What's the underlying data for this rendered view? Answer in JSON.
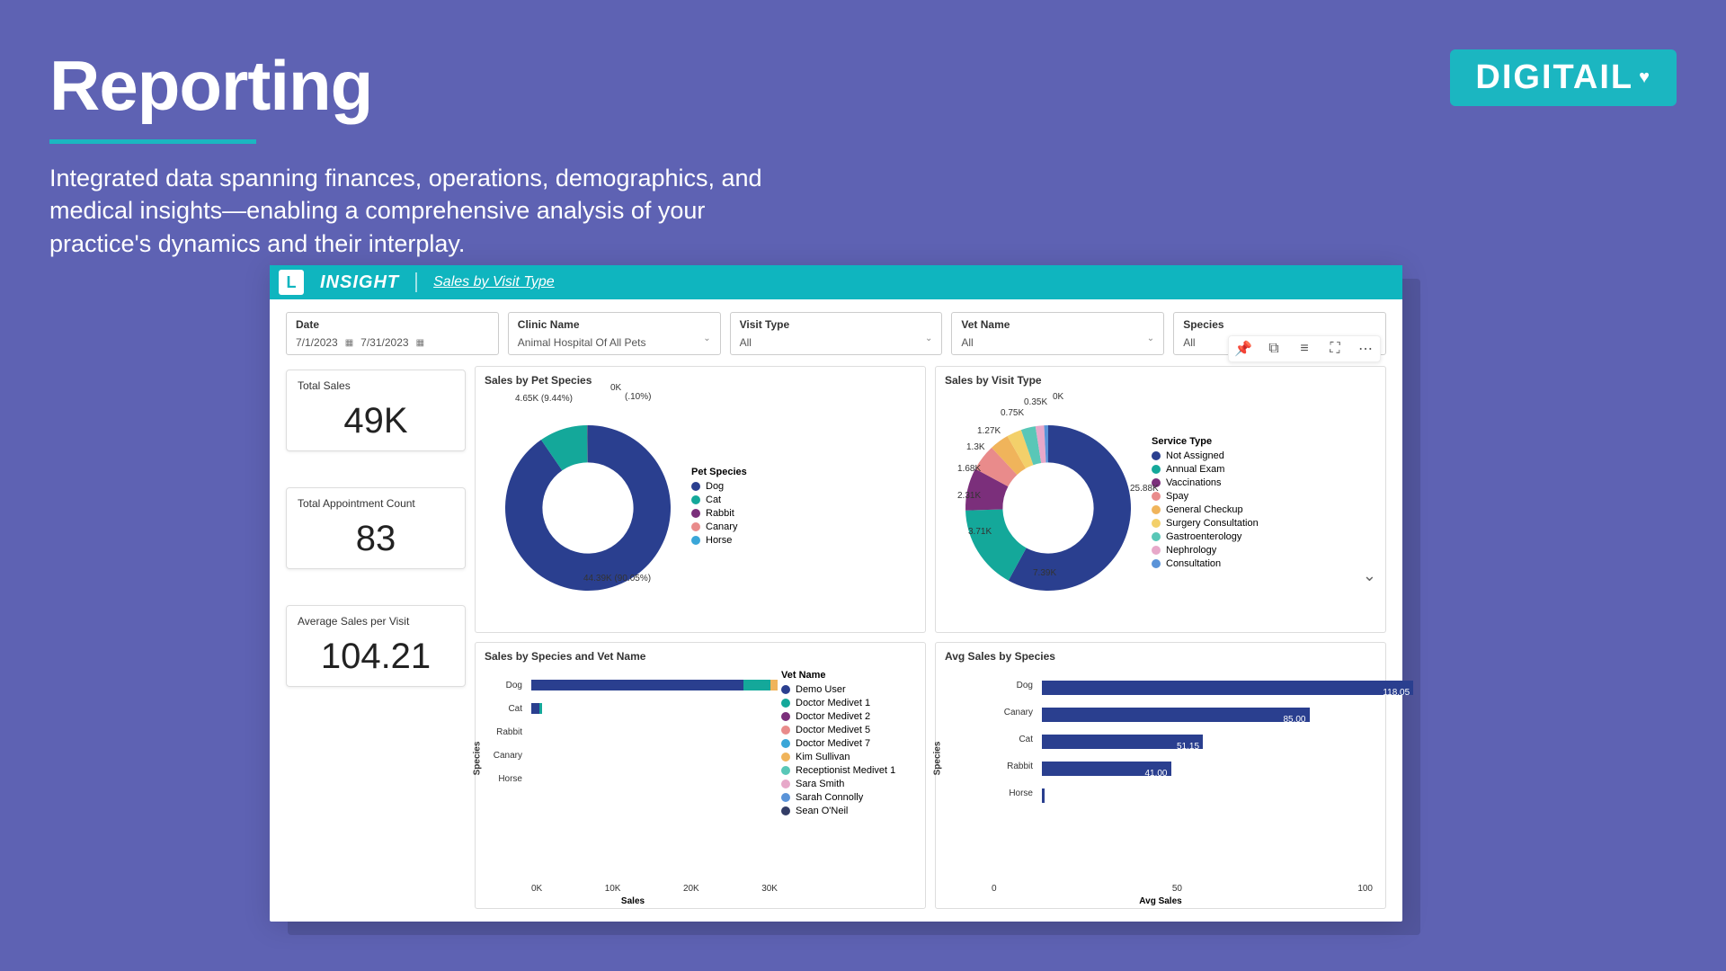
{
  "page": {
    "title": "Reporting",
    "subtitle": "Integrated data spanning finances, operations, demographics, and medical insights—enabling a comprehensive analysis of your practice's dynamics and their interplay."
  },
  "brand": {
    "name": "DIGITAIL"
  },
  "dashboard": {
    "product": "INSIGHT",
    "page_name": "Sales by Visit Type",
    "filters": {
      "date_label": "Date",
      "date_from": "7/1/2023",
      "date_to": "7/31/2023",
      "clinic_label": "Clinic Name",
      "clinic_value": "Animal Hospital Of All Pets",
      "visit_label": "Visit Type",
      "visit_value": "All",
      "vet_label": "Vet Name",
      "vet_value": "All",
      "species_label": "Species",
      "species_value": "All"
    },
    "kpis": {
      "total_sales_label": "Total Sales",
      "total_sales_value": "49K",
      "total_appt_label": "Total Appointment Count",
      "total_appt_value": "83",
      "avg_sales_label": "Average Sales per Visit",
      "avg_sales_value": "104.21"
    },
    "panel_species": {
      "title": "Sales by Pet Species",
      "legend_title": "Pet Species",
      "label_top": "0K",
      "label_pct_small": "(.10%)",
      "label_cat": "4.65K (9.44%)",
      "label_dog": "44.39K (90.05%)"
    },
    "panel_visit": {
      "title": "Sales by Visit Type",
      "legend_title": "Service Type",
      "dl": {
        "a": "25.88K",
        "b": "7.39K",
        "c": "3.71K",
        "d": "2.31K",
        "e": "1.68K",
        "f": "1.3K",
        "g": "1.27K",
        "h": "0.75K",
        "i": "0.35K",
        "j": "0K"
      }
    },
    "panel_stacked": {
      "title": "Sales by Species and Vet Name",
      "legend_title": "Vet Name",
      "y_title": "Species",
      "x_title": "Sales"
    },
    "panel_avg": {
      "title": "Avg Sales by Species",
      "y_title": "Species",
      "x_title": "Avg Sales"
    }
  },
  "chart_data": [
    {
      "id": "sales_by_pet_species",
      "type": "pie",
      "title": "Sales by Pet Species",
      "series": [
        {
          "name": "Dog",
          "value": 44.39,
          "pct": 90.05,
          "color": "#2a3f8f"
        },
        {
          "name": "Cat",
          "value": 4.65,
          "pct": 9.44,
          "color": "#14a89a"
        },
        {
          "name": "Rabbit",
          "value": 0.05,
          "pct": 0.1,
          "color": "#7b2f7b"
        },
        {
          "name": "Canary",
          "value": 0,
          "pct": 0,
          "color": "#e98b8b"
        },
        {
          "name": "Horse",
          "value": 0,
          "pct": 0,
          "color": "#3aa6d8"
        }
      ],
      "unit": "K"
    },
    {
      "id": "sales_by_visit_type",
      "type": "pie",
      "title": "Sales by Visit Type",
      "series": [
        {
          "name": "Not Assigned",
          "value": 25.88,
          "color": "#2a3f8f"
        },
        {
          "name": "Annual Exam",
          "value": 7.39,
          "color": "#14a89a"
        },
        {
          "name": "Vaccinations",
          "value": 3.71,
          "color": "#7b2f7b"
        },
        {
          "name": "Spay",
          "value": 2.31,
          "color": "#e98b8b"
        },
        {
          "name": "General Checkup",
          "value": 1.68,
          "color": "#f0b45b"
        },
        {
          "name": "Surgery Consultation",
          "value": 1.3,
          "color": "#f3d06a"
        },
        {
          "name": "Gastroenterology",
          "value": 1.27,
          "color": "#59c7b7"
        },
        {
          "name": "Nephrology",
          "value": 0.75,
          "color": "#e7a8c9"
        },
        {
          "name": "Consultation",
          "value": 0.35,
          "color": "#5a93d8"
        }
      ],
      "unit": "K"
    },
    {
      "id": "sales_by_species_and_vet",
      "type": "bar",
      "orientation": "horizontal",
      "stacked": true,
      "title": "Sales by Species and Vet Name",
      "categories": [
        "Dog",
        "Cat",
        "Rabbit",
        "Canary",
        "Horse"
      ],
      "series": [
        {
          "name": "Demo User",
          "color": "#2a3f8f",
          "values": [
            28,
            1.0,
            0,
            0,
            0
          ]
        },
        {
          "name": "Doctor Medivet 1",
          "color": "#14a89a",
          "values": [
            3.5,
            0.3,
            0,
            0,
            0
          ]
        },
        {
          "name": "Doctor Medivet 2",
          "color": "#7b2f7b",
          "values": [
            0,
            0,
            0,
            0,
            0
          ]
        },
        {
          "name": "Doctor Medivet 5",
          "color": "#e98b8b",
          "values": [
            0,
            0,
            0,
            0,
            0
          ]
        },
        {
          "name": "Doctor Medivet 7",
          "color": "#3aa6d8",
          "values": [
            0,
            0,
            0,
            0,
            0
          ]
        },
        {
          "name": "Kim Sullivan",
          "color": "#f0b45b",
          "values": [
            1.0,
            0,
            0,
            0,
            0
          ]
        },
        {
          "name": "Receptionist Medivet 1",
          "color": "#59c7b7",
          "values": [
            0,
            0,
            0,
            0,
            0
          ]
        },
        {
          "name": "Sara Smith",
          "color": "#e7a8c9",
          "values": [
            0,
            0,
            0,
            0,
            0
          ]
        },
        {
          "name": "Sarah Connolly",
          "color": "#5a93d8",
          "values": [
            0,
            0,
            0,
            0,
            0
          ]
        },
        {
          "name": "Sean O'Neil",
          "color": "#333d66",
          "values": [
            0,
            0,
            0,
            0,
            0
          ]
        }
      ],
      "xlabel": "Sales",
      "ylabel": "Species",
      "xticks": [
        "0K",
        "10K",
        "20K",
        "30K"
      ],
      "xlim": [
        0,
        30
      ]
    },
    {
      "id": "avg_sales_by_species",
      "type": "bar",
      "orientation": "horizontal",
      "title": "Avg Sales by Species",
      "categories": [
        "Dog",
        "Canary",
        "Cat",
        "Rabbit",
        "Horse"
      ],
      "values": [
        118.05,
        85.0,
        51.15,
        41.0,
        1
      ],
      "color": "#2a3f8f",
      "xlabel": "Avg Sales",
      "ylabel": "Species",
      "xticks": [
        "0",
        "50",
        "100"
      ],
      "xlim": [
        0,
        120
      ]
    }
  ]
}
